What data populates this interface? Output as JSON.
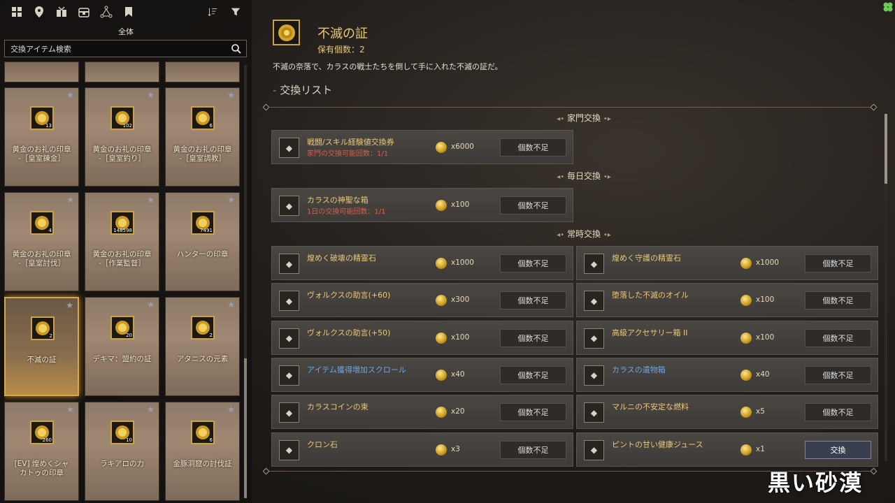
{
  "toolbar": {
    "icons": [
      "grid-icon",
      "map-pin-icon",
      "gift-icon",
      "chest-icon",
      "nodes-icon",
      "bookmark-icon"
    ],
    "sort_icon": "sort-icon",
    "filter_icon": "filter-icon",
    "category_label": "全体"
  },
  "search": {
    "placeholder": "交換アイテム検索"
  },
  "cards": [
    {
      "name": "黄金のお礼の印章\n-［皇室錬金］",
      "count": "13",
      "selected": false
    },
    {
      "name": "黄金のお礼の印章\n-［皇室釣り］",
      "count": "102",
      "selected": false
    },
    {
      "name": "黄金のお礼の印章\n-［皇室調教］",
      "count": "6",
      "selected": false
    },
    {
      "name": "黄金のお礼の印章\n-［皇室討伐］",
      "count": "4",
      "selected": false
    },
    {
      "name": "黄金のお礼の印章\n-［作業監督］",
      "count": "148598",
      "selected": false
    },
    {
      "name": "ハンターの印章",
      "count": "7491",
      "selected": false
    },
    {
      "name": "不滅の証",
      "count": "2",
      "selected": true
    },
    {
      "name": "デキマ：盟約の証",
      "count": "20",
      "selected": false
    },
    {
      "name": "アタニスの元素",
      "count": "2",
      "selected": false
    },
    {
      "name": "[EV] 煌めくシャ\nカトゥの印章",
      "count": "260",
      "selected": false
    },
    {
      "name": "ラキアロの力",
      "count": "10",
      "selected": false
    },
    {
      "name": "金豚洞窟の討伐証",
      "count": "6",
      "selected": false
    }
  ],
  "detail": {
    "title": "不滅の証",
    "owned": "保有個数：2",
    "description": "不滅の奈落で、カラスの戦士たちを倒して手に入れた不滅の証だ。",
    "list_title": "交換リスト"
  },
  "sections": {
    "family": "家門交換",
    "daily": "毎日交換",
    "permanent": "常時交換"
  },
  "family_rows": [
    {
      "name": "戦闘/スキル経験値交換券",
      "sub": "家門の交換可能回数：1/1",
      "price": "x6000",
      "button": "個数不足"
    }
  ],
  "daily_rows": [
    {
      "name": "カラスの神聖な箱",
      "sub": "1日の交換可能回数：1/1",
      "price": "x100",
      "button": "個数不足"
    }
  ],
  "permanent_rows": [
    {
      "name": "煌めく破壊の精霊石",
      "price": "x1000",
      "button": "個数不足",
      "blue": false
    },
    {
      "name": "煌めく守護の精霊石",
      "price": "x1000",
      "button": "個数不足",
      "blue": false
    },
    {
      "name": "ヴォルクスの助言(+60)",
      "price": "x300",
      "button": "個数不足",
      "blue": false
    },
    {
      "name": "堕落した不滅のオイル",
      "price": "x100",
      "button": "個数不足",
      "blue": false
    },
    {
      "name": "ヴォルクスの助言(+50)",
      "price": "x100",
      "button": "個数不足",
      "blue": false
    },
    {
      "name": "高級アクセサリー箱 II",
      "price": "x100",
      "button": "個数不足",
      "blue": false
    },
    {
      "name": "アイテム獲得増加スクロール",
      "price": "x40",
      "button": "個数不足",
      "blue": true
    },
    {
      "name": "カラスの遺物箱",
      "price": "x40",
      "button": "個数不足",
      "blue": true
    },
    {
      "name": "カラスコインの束",
      "price": "x20",
      "button": "個数不足",
      "blue": false
    },
    {
      "name": "マルニの不安定な燃料",
      "price": "x5",
      "button": "個数不足",
      "blue": false
    },
    {
      "name": "クロン石",
      "price": "x3",
      "button": "個数不足",
      "blue": false
    },
    {
      "name": "ピントの甘い健康ジュース",
      "price": "x1",
      "button": "交換",
      "blue": false
    }
  ],
  "logo": "黒い砂漠"
}
